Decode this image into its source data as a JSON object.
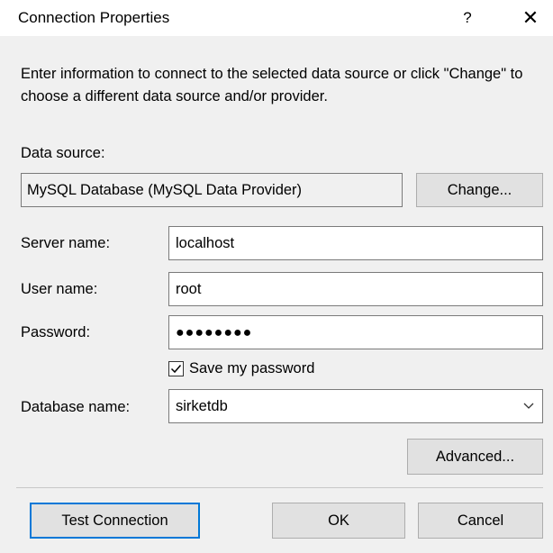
{
  "window": {
    "title": "Connection Properties",
    "help_glyph": "?",
    "close_glyph": "✕"
  },
  "instructions": "Enter information to connect to the selected data source or click \"Change\" to choose a different data source and/or provider.",
  "data_source": {
    "label": "Data source:",
    "value": "MySQL Database (MySQL Data Provider)",
    "change_button": "Change..."
  },
  "server": {
    "label": "Server name:",
    "value": "localhost"
  },
  "user": {
    "label": "User name:",
    "value": "root"
  },
  "password": {
    "label": "Password:",
    "value": "●●●●●●●●"
  },
  "save_password": {
    "label": "Save my password",
    "checked": true
  },
  "database": {
    "label": "Database name:",
    "value": "sirketdb"
  },
  "buttons": {
    "advanced": "Advanced...",
    "test_connection": "Test Connection",
    "ok": "OK",
    "cancel": "Cancel"
  },
  "colors": {
    "dialog_bg": "#f0f0f0",
    "titlebar_bg": "#ffffff",
    "button_bg": "#e1e1e1",
    "focus_border": "#0078d7",
    "input_border": "#7a7a7a"
  },
  "icons": {
    "help": "help-icon",
    "close": "close-icon",
    "checkbox": "checkmark-icon",
    "dropdown": "chevron-down-icon"
  }
}
